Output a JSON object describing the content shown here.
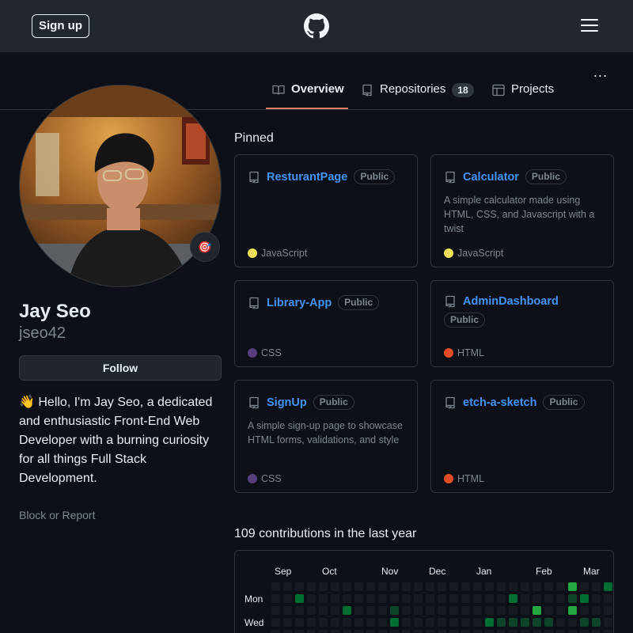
{
  "header": {
    "signup_label": "Sign up",
    "logo_icon": "github-logo-icon",
    "menu_icon": "hamburger-menu-icon"
  },
  "nav": {
    "more_label": "...",
    "tabs": [
      {
        "label": "Overview",
        "icon": "book-icon",
        "active": true
      },
      {
        "label": "Repositories",
        "icon": "repo-icon",
        "count": "18"
      },
      {
        "label": "Projects",
        "icon": "table-icon"
      }
    ]
  },
  "profile": {
    "status_emoji": "🎯",
    "name": "Jay Seo",
    "username": "jseo42",
    "follow_label": "Follow",
    "bio": "👋 Hello, I'm Jay Seo, a dedicated and enthusiastic Front-End Web Developer with a burning curiosity for all things Full Stack Development.",
    "block_report_label": "Block or Report"
  },
  "pinned": {
    "title": "Pinned",
    "repos": [
      {
        "name": "ResturantPage",
        "visibility": "Public",
        "description": "",
        "language": "JavaScript",
        "language_color": "#f1e05a"
      },
      {
        "name": "Calculator",
        "visibility": "Public",
        "description": "A simple calculator made using HTML, CSS, and Javascript with a twist",
        "language": "JavaScript",
        "language_color": "#f1e05a"
      },
      {
        "name": "Library-App",
        "visibility": "Public",
        "description": "",
        "language": "CSS",
        "language_color": "#563d7c"
      },
      {
        "name": "AdminDashboard",
        "visibility": "Public",
        "description": "",
        "language": "HTML",
        "language_color": "#e34c26"
      },
      {
        "name": "SignUp",
        "visibility": "Public",
        "description": "A simple sign-up page to showcase HTML forms, validations, and style",
        "language": "CSS",
        "language_color": "#563d7c"
      },
      {
        "name": "etch-a-sketch",
        "visibility": "Public",
        "description": "",
        "language": "HTML",
        "language_color": "#e34c26"
      }
    ]
  },
  "contributions": {
    "title": "109 contributions in the last year",
    "months": [
      "Sep",
      "Oct",
      "Nov",
      "Dec",
      "Jan",
      "Feb",
      "Mar"
    ],
    "days": [
      "Mon",
      "Wed"
    ],
    "colors": {
      "empty": "#161b22",
      "l1": "#0e4429",
      "l2": "#006d32",
      "l3": "#26a641"
    }
  }
}
